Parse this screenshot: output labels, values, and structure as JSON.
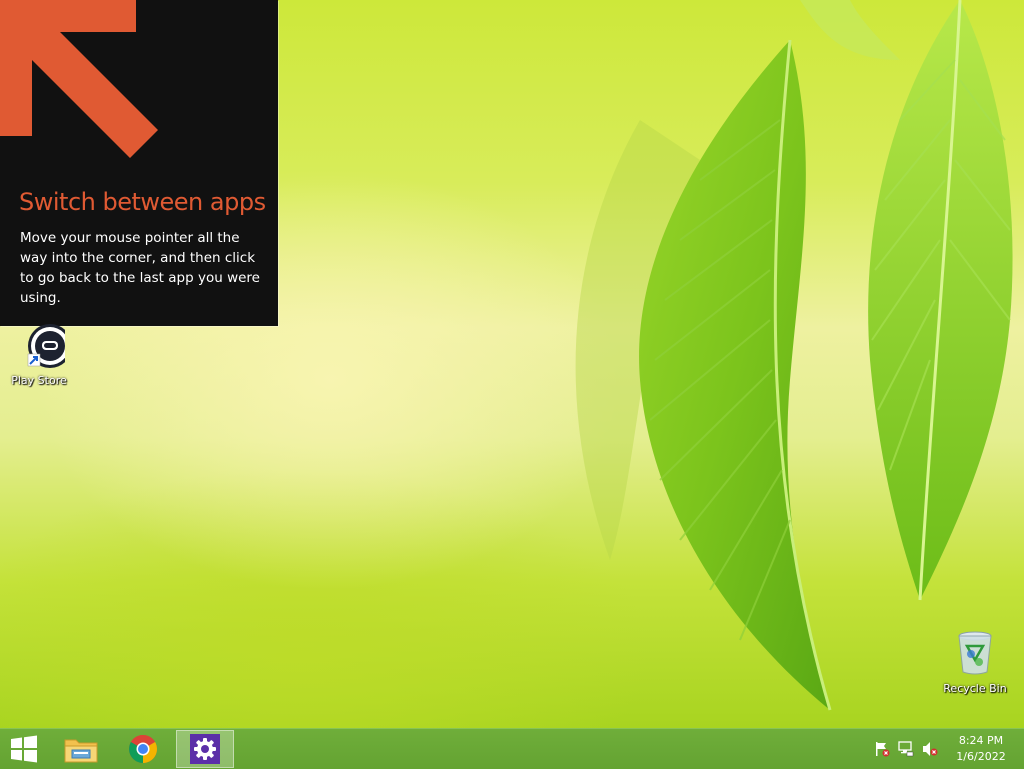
{
  "tip": {
    "title": "Switch between apps",
    "body": "Move your mouse pointer all the way into the corner, and then click to go back to the last app you were using."
  },
  "desktop_icons": [
    {
      "label": "Play Store",
      "icon": "play-store-icon"
    },
    {
      "label": "Recycle Bin",
      "icon": "recycle-bin-icon"
    }
  ],
  "taskbar": {
    "items": [
      {
        "name": "start",
        "icon": "windows-logo-icon"
      },
      {
        "name": "file-explorer",
        "icon": "file-explorer-icon"
      },
      {
        "name": "chrome",
        "icon": "chrome-icon"
      },
      {
        "name": "settings",
        "icon": "gear-icon",
        "active": true
      }
    ],
    "tray": [
      {
        "name": "action-center",
        "icon": "flag-warning-icon"
      },
      {
        "name": "network",
        "icon": "network-icon"
      },
      {
        "name": "volume",
        "icon": "volume-muted-icon"
      }
    ],
    "time": "8:24 PM",
    "date": "1/6/2022"
  },
  "colors": {
    "tip_accent": "#e05a33",
    "tip_background": "#111111",
    "taskbar": "#6aa836",
    "settings_tile": "#5b2fa8"
  }
}
